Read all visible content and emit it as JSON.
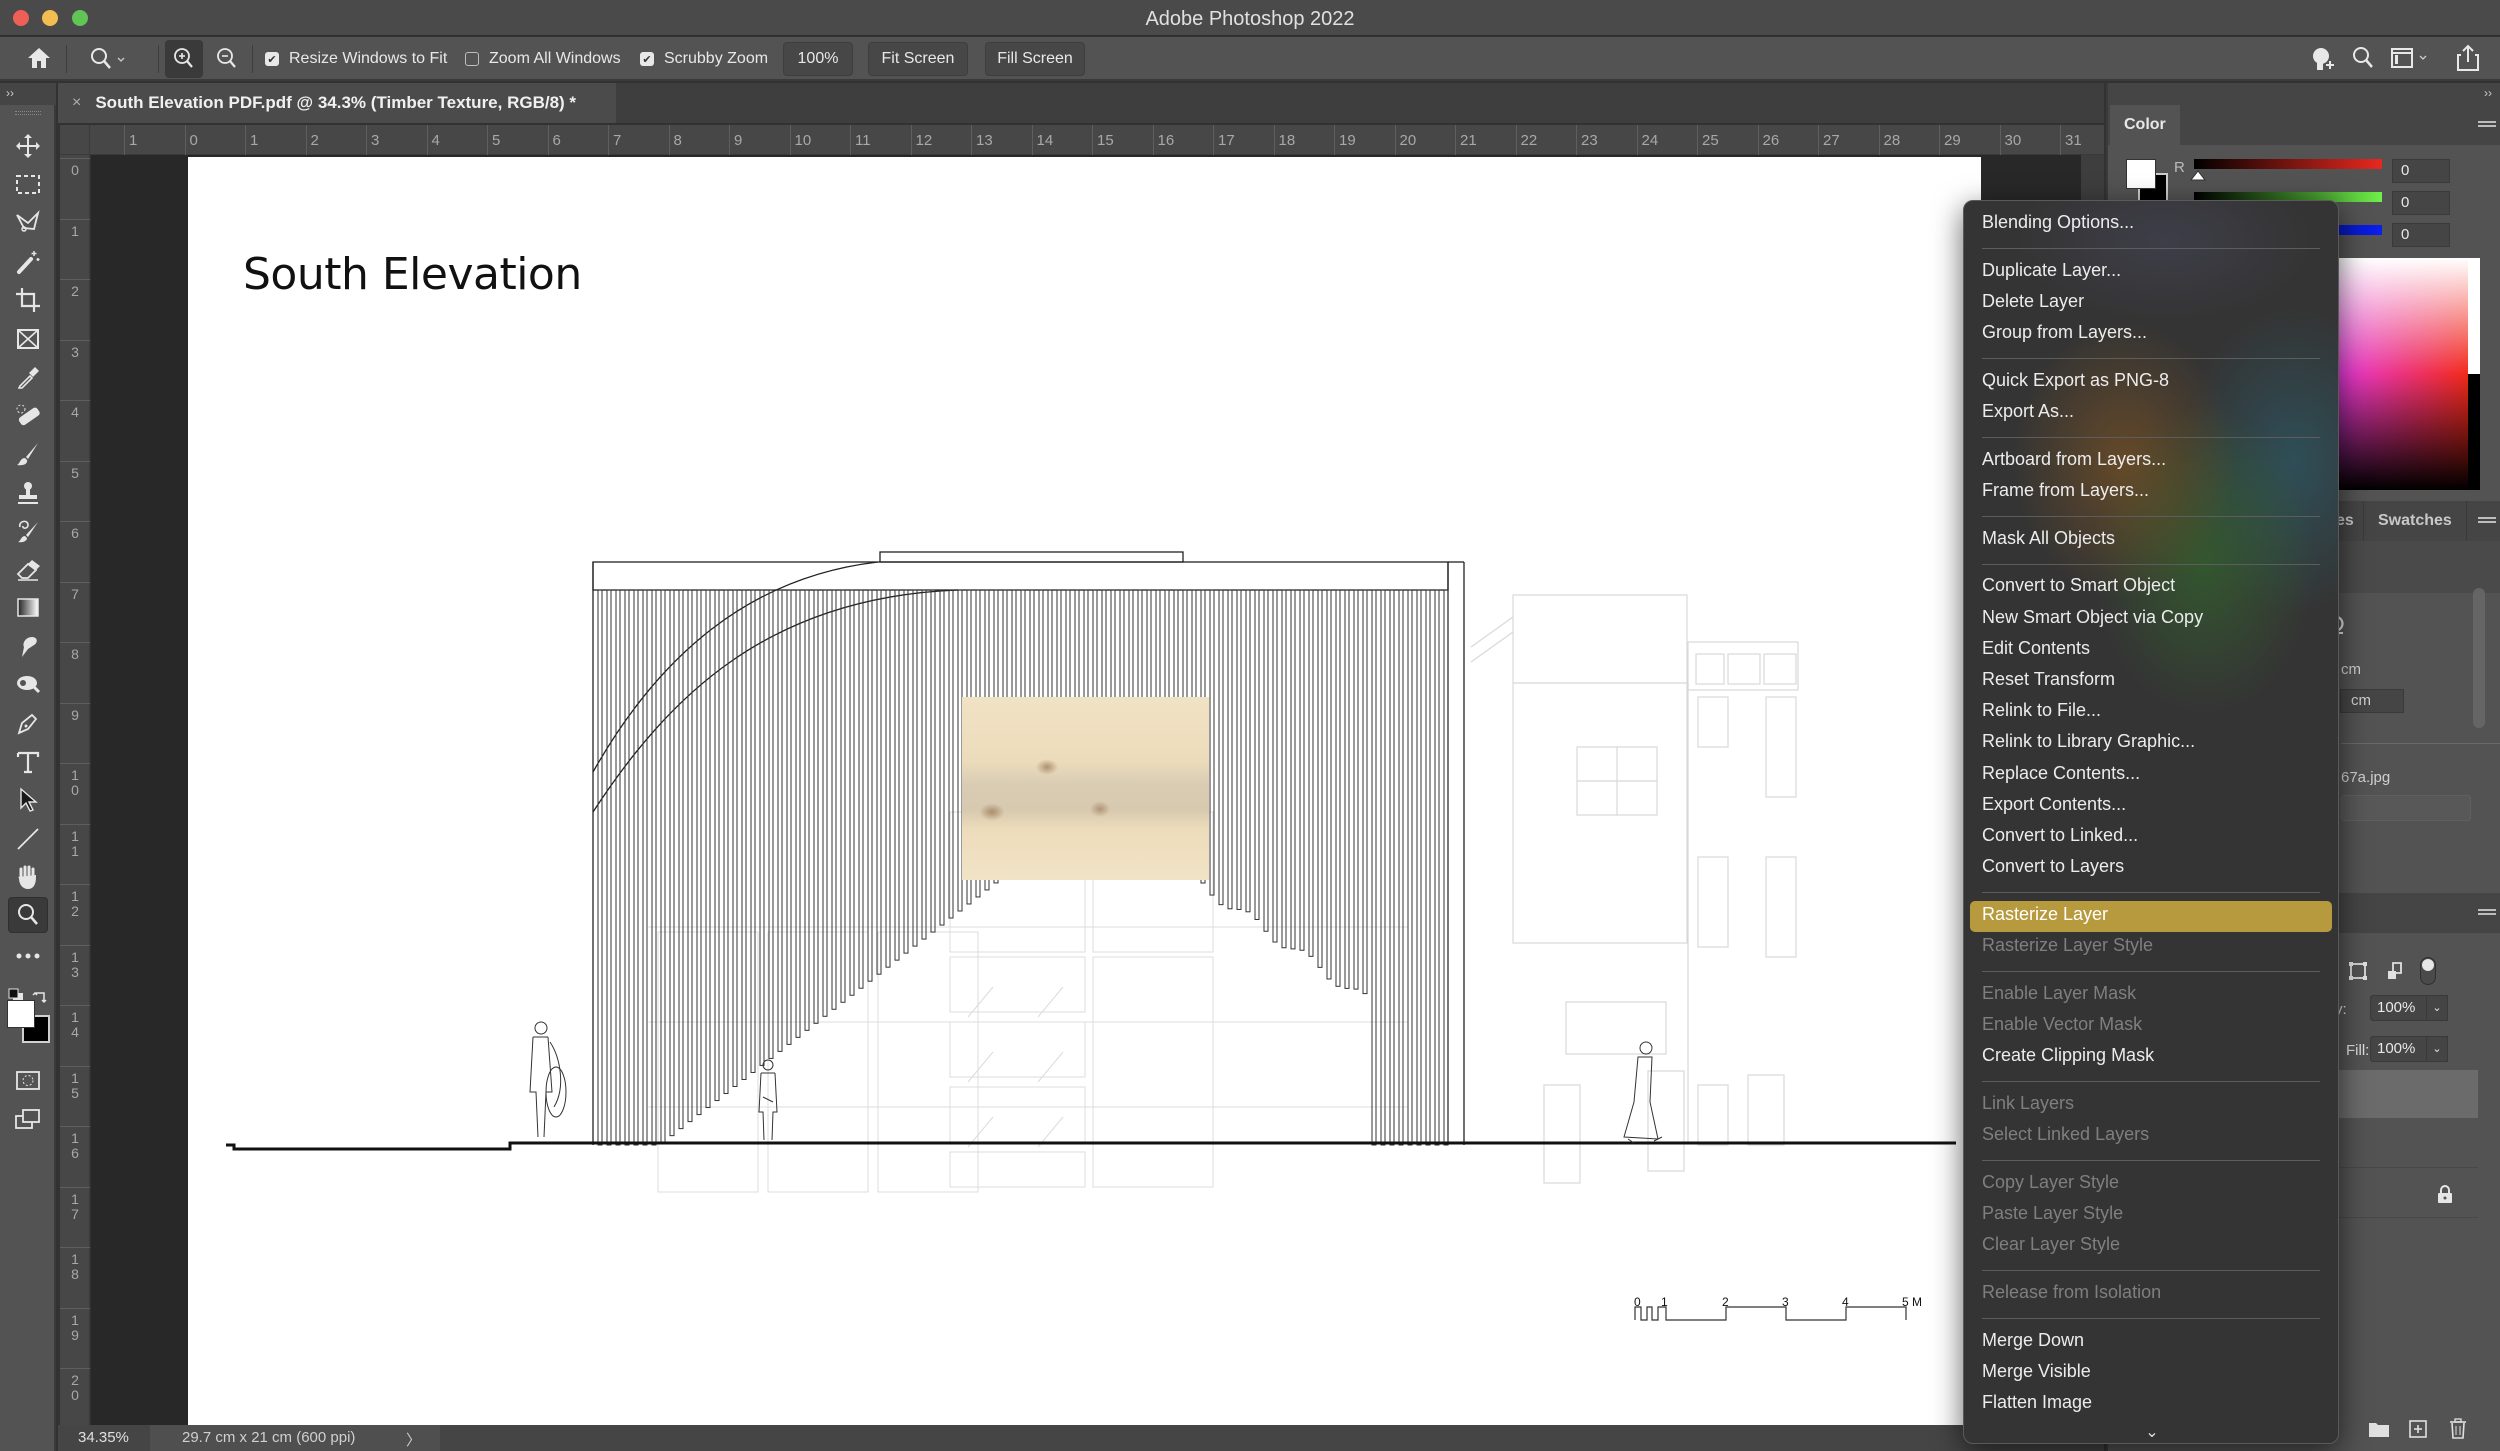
{
  "app": {
    "title": "Adobe Photoshop 2022"
  },
  "options_bar": {
    "resize_windows_label": "Resize Windows to Fit",
    "resize_windows_checked": true,
    "zoom_all_label": "Zoom All Windows",
    "zoom_all_checked": false,
    "scrubby_label": "Scrubby Zoom",
    "scrubby_checked": true,
    "zoom_percent": "100%",
    "fit_screen": "Fit Screen",
    "fill_screen": "Fill Screen",
    "icons": [
      "home-icon",
      "zoom-tool-icon",
      "zoom-in-icon",
      "zoom-out-icon",
      "learn-icon",
      "search-icon",
      "workspace-icon",
      "share-icon"
    ]
  },
  "document": {
    "tab_title": "South Elevation PDF.pdf @ 34.3% (Timber Texture, RGB/8) *",
    "close_glyph": "×",
    "heading": "South Elevation",
    "scale_bar": {
      "labels": [
        "0",
        "1",
        "2",
        "3",
        "4",
        "5 M"
      ]
    }
  },
  "rulers": {
    "top": [
      "1",
      "0",
      "1",
      "2",
      "3",
      "4",
      "5",
      "6",
      "7",
      "8",
      "9",
      "10",
      "11",
      "12",
      "13",
      "14",
      "15",
      "16",
      "17",
      "18",
      "19",
      "20",
      "21",
      "22",
      "23",
      "24",
      "25",
      "26",
      "27",
      "28",
      "29",
      "30",
      "31"
    ],
    "left": [
      "0",
      "1",
      "2",
      "3",
      "4",
      "5",
      "6",
      "7",
      "8",
      "9",
      "10",
      "11",
      "12",
      "13",
      "14",
      "15",
      "16",
      "17",
      "18",
      "19",
      "20"
    ]
  },
  "toolbar": {
    "tools": [
      "move",
      "marquee",
      "lasso",
      "magic-wand",
      "crop",
      "frame",
      "eyedropper",
      "healing-brush",
      "brush",
      "clone-stamp",
      "history-brush",
      "eraser",
      "gradient",
      "smudge",
      "dodge",
      "pen",
      "type",
      "path-selection",
      "line",
      "hand",
      "zoom",
      "more"
    ],
    "active_tool": "zoom",
    "foreground_color": "#ffffff",
    "background_color": "#000000"
  },
  "status": {
    "zoom": "34.35%",
    "doc_size": "29.7 cm x 21 cm (600 ppi)",
    "arrow": "〉"
  },
  "color_panel": {
    "tab": "Color",
    "r": "0",
    "g": "0",
    "b": "0",
    "r_label": "R"
  },
  "swatches_panel": {
    "tab_partial": "es",
    "tab": "Swatches"
  },
  "properties_panel": {
    "unit1": "cm",
    "unit2": "cm",
    "file": "67a.jpg"
  },
  "layers_panel": {
    "opacity_label": "city:",
    "opacity": "100%",
    "fill_label": "Fill:",
    "fill": "100%"
  },
  "context_menu": {
    "highlight_color": "#b89a3e",
    "groups": [
      [
        {
          "label": "Blending Options...",
          "enabled": true
        }
      ],
      [
        {
          "label": "Duplicate Layer...",
          "enabled": true
        },
        {
          "label": "Delete Layer",
          "enabled": true
        },
        {
          "label": "Group from Layers...",
          "enabled": true
        }
      ],
      [
        {
          "label": "Quick Export as PNG-8",
          "enabled": true
        },
        {
          "label": "Export As...",
          "enabled": true
        }
      ],
      [
        {
          "label": "Artboard from Layers...",
          "enabled": true
        },
        {
          "label": "Frame from Layers...",
          "enabled": true
        }
      ],
      [
        {
          "label": "Mask All Objects",
          "enabled": true
        }
      ],
      [
        {
          "label": "Convert to Smart Object",
          "enabled": true
        },
        {
          "label": "New Smart Object via Copy",
          "enabled": true
        },
        {
          "label": "Edit Contents",
          "enabled": true
        },
        {
          "label": "Reset Transform",
          "enabled": true
        },
        {
          "label": "Relink to File...",
          "enabled": true
        },
        {
          "label": "Relink to Library Graphic...",
          "enabled": true
        },
        {
          "label": "Replace Contents...",
          "enabled": true
        },
        {
          "label": "Export Contents...",
          "enabled": true
        },
        {
          "label": "Convert to Linked...",
          "enabled": true
        },
        {
          "label": "Convert to Layers",
          "enabled": true
        }
      ],
      [
        {
          "label": "Rasterize Layer",
          "enabled": true,
          "highlighted": true
        },
        {
          "label": "Rasterize Layer Style",
          "enabled": false
        }
      ],
      [
        {
          "label": "Enable Layer Mask",
          "enabled": false
        },
        {
          "label": "Enable Vector Mask",
          "enabled": false
        },
        {
          "label": "Create Clipping Mask",
          "enabled": true
        }
      ],
      [
        {
          "label": "Link Layers",
          "enabled": false
        },
        {
          "label": "Select Linked Layers",
          "enabled": false
        }
      ],
      [
        {
          "label": "Copy Layer Style",
          "enabled": false
        },
        {
          "label": "Paste Layer Style",
          "enabled": false
        },
        {
          "label": "Clear Layer Style",
          "enabled": false
        }
      ],
      [
        {
          "label": "Release from Isolation",
          "enabled": false
        }
      ],
      [
        {
          "label": "Merge Down",
          "enabled": true
        },
        {
          "label": "Merge Visible",
          "enabled": true
        },
        {
          "label": "Flatten Image",
          "enabled": true
        }
      ]
    ],
    "scroll_glyph": "⌄"
  }
}
